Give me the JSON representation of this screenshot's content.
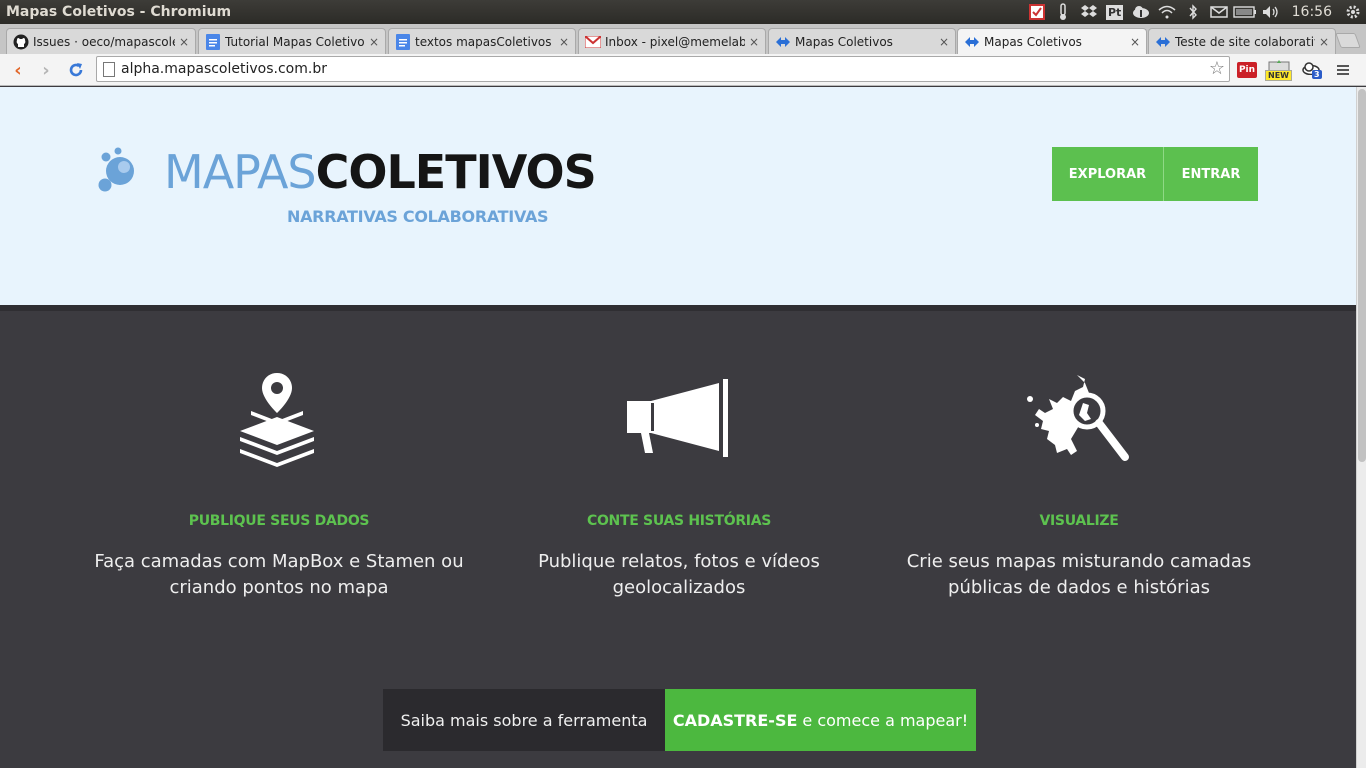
{
  "os": {
    "window_title": "Mapas Coletivos - Chromium",
    "clock": "16:56",
    "tray_icons": [
      "tasks-icon",
      "weather-icon",
      "dropbox-icon",
      "pivotal-icon",
      "upload-cloud-icon",
      "wifi-icon",
      "bluetooth-icon",
      "mail-icon",
      "battery-icon",
      "volume-icon",
      "power-gear-icon"
    ],
    "tray_pt_label": "Pt"
  },
  "tabs": [
    {
      "label": "Issues · oeco/mapascolet",
      "icon": "github-icon"
    },
    {
      "label": "Tutorial Mapas Coletivos",
      "icon": "google-docs-icon"
    },
    {
      "label": "textos mapasColetivos - G",
      "icon": "google-docs-icon"
    },
    {
      "label": "Inbox - pixel@memelab.c",
      "icon": "gmail-icon"
    },
    {
      "label": "Mapas Coletivos",
      "icon": "mapas-icon"
    },
    {
      "label": "Mapas Coletivos",
      "icon": "mapas-icon",
      "active": true
    },
    {
      "label": "Teste de site colaborativ",
      "icon": "mapas-icon"
    }
  ],
  "toolbar": {
    "url": "alpha.mapascoletivos.com.br",
    "ext_pin_label": "Pin",
    "ext_new_label": "NEW",
    "ext_badge_count": "3"
  },
  "site": {
    "logo_light": "MAPAS",
    "logo_bold": "COLETIVOS",
    "tagline": "NARRATIVAS COLABORATIVAS",
    "nav": {
      "explore": "EXPLORAR",
      "enter": "ENTRAR"
    },
    "features": [
      {
        "title": "PUBLIQUE SEUS DADOS",
        "desc": "Faça camadas com MapBox e Stamen ou criando pontos no mapa",
        "icon": "map-layers-icon"
      },
      {
        "title": "CONTE SUAS HISTÓRIAS",
        "desc": "Publique relatos, fotos e vídeos geolocalizados",
        "icon": "megaphone-icon"
      },
      {
        "title": "VISUALIZE",
        "desc": "Crie seus mapas misturando camadas públicas de dados e histórias",
        "icon": "map-magnifier-icon"
      }
    ],
    "cta": {
      "learn": "Saiba mais sobre a ferramenta",
      "signup_bold": "CADASTRE-SE",
      "signup_rest": "e comece a mapear!"
    }
  },
  "colors": {
    "accent_green": "#5cc04f",
    "hero_bg": "#e8f4fd",
    "dark_bg": "#3c3b40",
    "logo_blue": "#6ba3d8"
  }
}
